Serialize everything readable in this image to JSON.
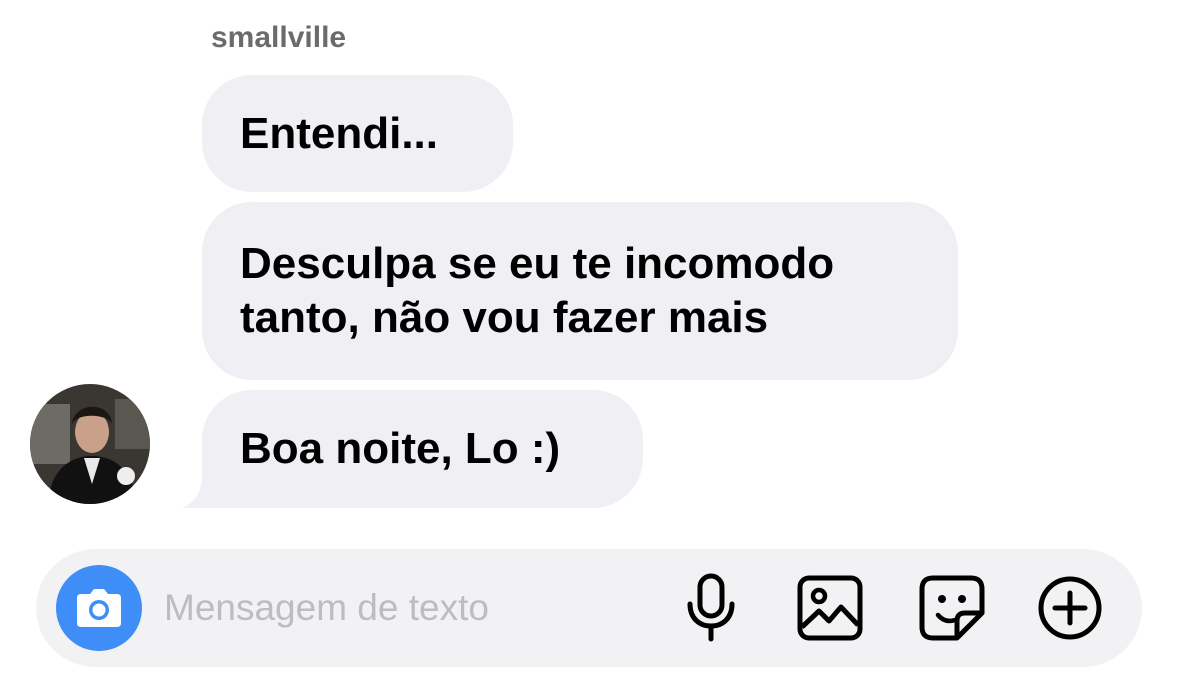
{
  "thread": {
    "sender_name": "smallville"
  },
  "messages": [
    {
      "text": "Entendi..."
    },
    {
      "text": "Desculpa se eu te incomodo tanto, não vou fazer mais"
    },
    {
      "text": "Boa noite, Lo :)"
    }
  ],
  "composer": {
    "placeholder": "Mensagem de texto",
    "value": "",
    "icons": [
      "camera-icon",
      "microphone-icon",
      "image-icon",
      "sticker-icon",
      "plus-icon"
    ]
  },
  "colors": {
    "bubble_bg": "#efeff4",
    "composer_bg": "#f2f2f4",
    "camera_accent": "#3f8ef7",
    "placeholder": "#bdbdc1",
    "sender_text": "#6b6b6b"
  }
}
